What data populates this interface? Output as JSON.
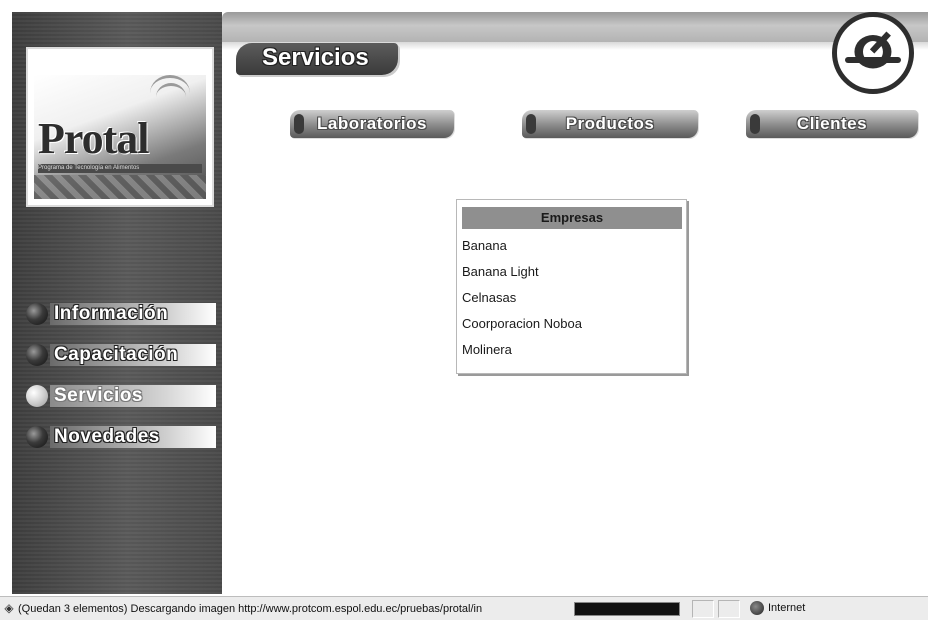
{
  "header": {
    "page_title": "Servicios"
  },
  "logo": {
    "text": "Protal",
    "tagline": "Programa de Tecnología en Alimentos"
  },
  "sidebar": {
    "items": [
      {
        "label": "Información",
        "active": false
      },
      {
        "label": "Capacitación",
        "active": false
      },
      {
        "label": "Servicios",
        "active": true
      },
      {
        "label": "Novedades",
        "active": false
      }
    ]
  },
  "subnav": {
    "items": [
      {
        "label": "Laboratorios"
      },
      {
        "label": "Productos"
      },
      {
        "label": "Clientes"
      }
    ]
  },
  "dropdown": {
    "header": "Empresas",
    "items": [
      "Banana",
      "Banana Light",
      "Celnasas",
      "Coorporacion Noboa",
      "Molinera"
    ]
  },
  "statusbar": {
    "text": "(Quedan 3 elementos) Descargando imagen http://www.protcom.espol.edu.ec/pruebas/protal/in",
    "zone": "Internet"
  },
  "icons": {
    "status": "ie-page-icon",
    "zone": "globe-icon",
    "corner": "espol-logo-icon"
  }
}
